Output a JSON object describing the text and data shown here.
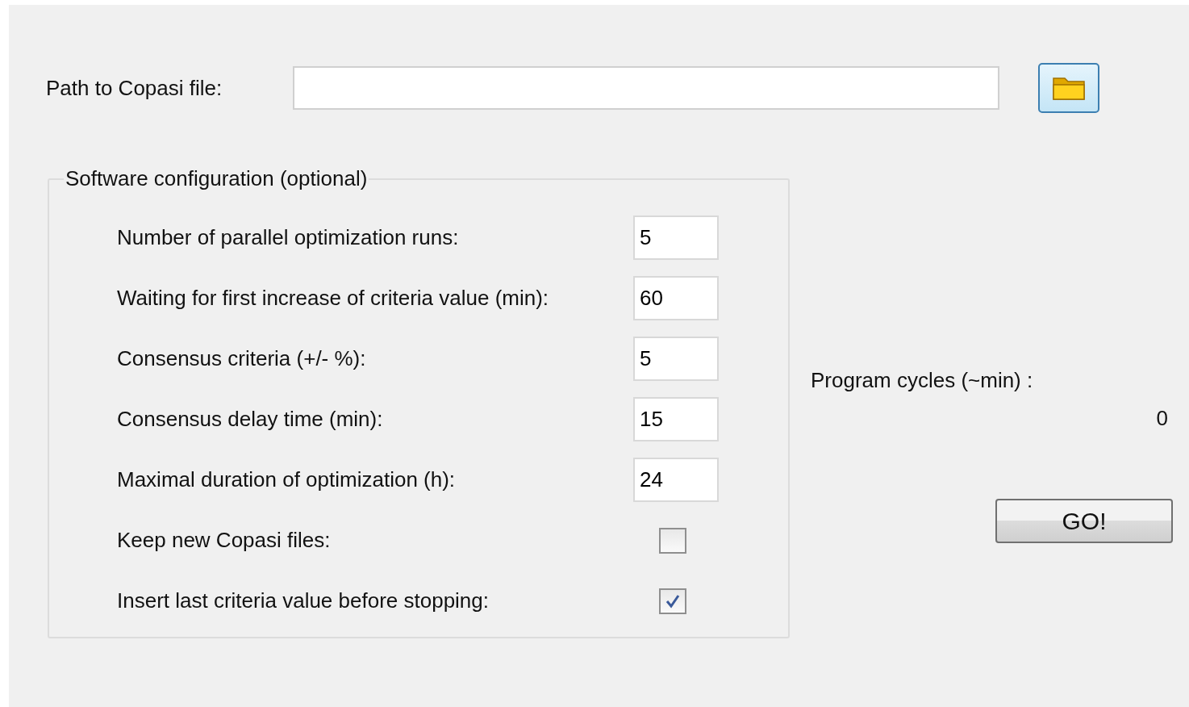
{
  "path_field": {
    "label": "Path to Copasi file:"
  },
  "config": {
    "title": "Software configuration (optional)",
    "rows": [
      {
        "kind": "number",
        "label": "Number of parallel optimization runs:",
        "value": "5"
      },
      {
        "kind": "number",
        "label": "Waiting for first increase of criteria value (min):",
        "value": "60"
      },
      {
        "kind": "number",
        "label": "Consensus criteria (+/- %):",
        "value": "5"
      },
      {
        "kind": "number",
        "label": "Consensus delay time (min):",
        "value": "15"
      },
      {
        "kind": "number",
        "label": "Maximal duration of optimization (h):",
        "value": "24"
      },
      {
        "kind": "checkbox",
        "label": "Keep new Copasi files:",
        "checked": false
      },
      {
        "kind": "checkbox",
        "label": "Insert last criteria value before stopping:",
        "checked": true
      }
    ]
  },
  "program_cycles": {
    "label": "Program cycles (~min) :",
    "value": "0"
  },
  "go_button": "GO!"
}
